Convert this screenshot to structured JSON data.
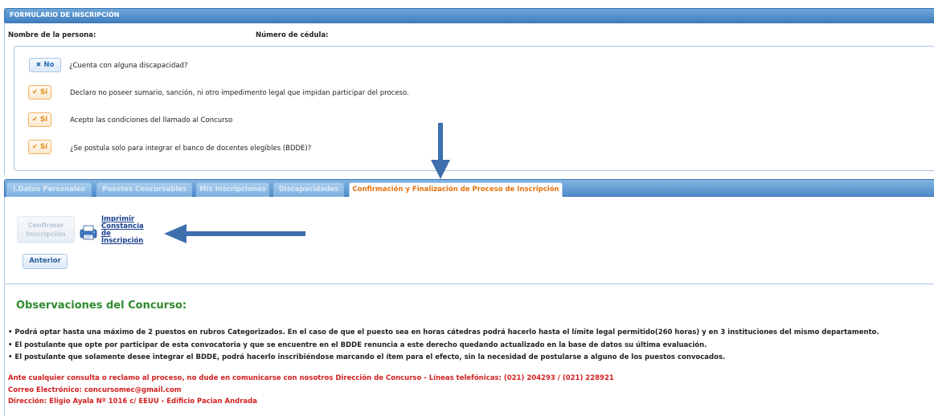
{
  "form": {
    "title": "FORMULARIO DE INSCRIPCIÓN",
    "person_label": "Nombre de la persona:",
    "id_label": "Número de cédula:"
  },
  "questions": [
    {
      "answer": "No",
      "text": "¿Cuenta con alguna discapacidad?"
    },
    {
      "answer": "Sí",
      "text": "Declaro no poseer sumario, sanción, ni otro impedimento legal que impidan participar del proceso."
    },
    {
      "answer": "Sí",
      "text": "Acepto las condiciones del llamado al Concurso"
    },
    {
      "answer": "Sí",
      "text": "¿Se postula solo para integrar el banco de docentes elegibles (BDDE)?"
    }
  ],
  "tabs": [
    {
      "label": "I.Datos Personales"
    },
    {
      "label": "Puestos Concursables"
    },
    {
      "label": "Mis Inscripciones"
    },
    {
      "label": "Discapacidades"
    },
    {
      "label": "Confirmación y Finalización de Proceso de Inscripción"
    }
  ],
  "actions": {
    "confirm_line1": "Confirmar",
    "confirm_line2": "Inscripción",
    "print_line1": "Imprimir",
    "print_line2": "Constancia",
    "print_line3": "de",
    "print_line4": "Inscripción",
    "previous": "Anterior"
  },
  "observations": {
    "title": "Observaciones del Concurso:",
    "items": [
      "• Podrá optar hasta una máximo de 2 puestos en rubros Categorizados. En el caso de que el puesto sea en horas cátedras podrá hacerlo hasta el límite legal permitido(260 horas) y en 3 instituciones del mismo departamento.",
      "• El postulante que opte por participar de esta convocatoria y que se encuentre en el BDDE renuncia a este derecho quedando actualizado en la base de datos su última evaluación.",
      "• El postulante que solamente desee integrar el BDDE, podrá hacerlo inscribiéndose marcando el ítem para el efecto, sin la necesidad de postularse a alguno de los puestos convocados."
    ]
  },
  "contact": {
    "line1": "Ante cualquier consulta o reclamo al proceso, no dude en comunicarse con nosotros Dirección de Concurso - Líneas telefónicas: (021) 204293 / (021) 228921",
    "line2": "Correo Electrónico: concursomec@gmail.com",
    "line3": "Dirección: Eligio Ayala Nº 1016 c/ EEUU - Edificio Pacian Andrada"
  },
  "colors": {
    "accent": "#e8730f",
    "header": "#3f7fc1",
    "annotation_arrow": "#3d6fad",
    "observations_title": "#2e8b2e",
    "contact": "#d11f1f"
  },
  "icons": {
    "no": "close-icon",
    "yes": "check-icon",
    "print": "printer-icon"
  }
}
